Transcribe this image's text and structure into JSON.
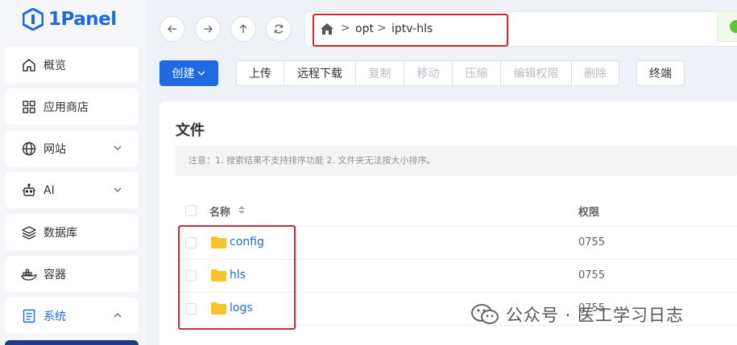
{
  "app": {
    "logo_text": "1Panel"
  },
  "sidebar": {
    "items": [
      {
        "label": "概览",
        "icon": "home-icon"
      },
      {
        "label": "应用商店",
        "icon": "grid-icon"
      },
      {
        "label": "网站",
        "icon": "globe-icon"
      },
      {
        "label": "AI",
        "icon": "robot-icon"
      },
      {
        "label": "数据库",
        "icon": "layers-icon"
      },
      {
        "label": "容器",
        "icon": "docker-icon"
      },
      {
        "label": "系统",
        "icon": "system-icon"
      }
    ]
  },
  "path": {
    "segments": [
      "opt",
      "iptv-hls"
    ],
    "separator": ">"
  },
  "toolbar": {
    "create_label": "创建",
    "upload": "上传",
    "remote_download": "远程下载",
    "copy": "复制",
    "move": "移动",
    "compress": "压缩",
    "edit_permission": "编辑权限",
    "delete": "删除",
    "terminal": "终端"
  },
  "panel": {
    "title": "文件",
    "notice": "注意：1. 搜索结果不支持排序功能 2. 文件夹无法按大小排序。"
  },
  "table": {
    "headers": {
      "name": "名称",
      "permission": "权限"
    },
    "rows": [
      {
        "name": "config",
        "permission": "0755"
      },
      {
        "name": "hls",
        "permission": "0755"
      },
      {
        "name": "logs",
        "permission": "0755"
      }
    ]
  },
  "watermark": {
    "text": "公众号 · 医工学习日志"
  },
  "colors": {
    "accent": "#1f6ae0",
    "highlight_box": "#e0242f",
    "folder": "#f7c52b"
  }
}
